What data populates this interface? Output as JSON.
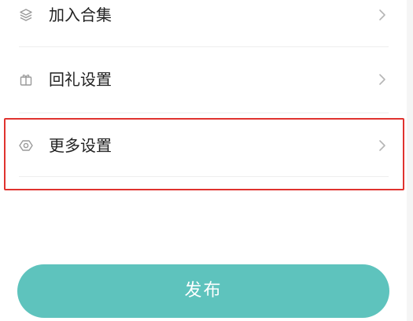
{
  "settings_list": {
    "items": [
      {
        "label": "加入合集",
        "icon": "layers-icon"
      },
      {
        "label": "回礼设置",
        "icon": "gift-icon"
      },
      {
        "label": "更多设置",
        "icon": "hexagon-settings-icon"
      }
    ],
    "chevron_icon": "chevron-right-icon"
  },
  "publish_button": {
    "label": "发布"
  },
  "colors": {
    "accent": "#5ec3bd",
    "highlight_border": "#e0332f",
    "text": "#222222",
    "icon": "#9a9a9a",
    "divider": "#eeeeee"
  }
}
